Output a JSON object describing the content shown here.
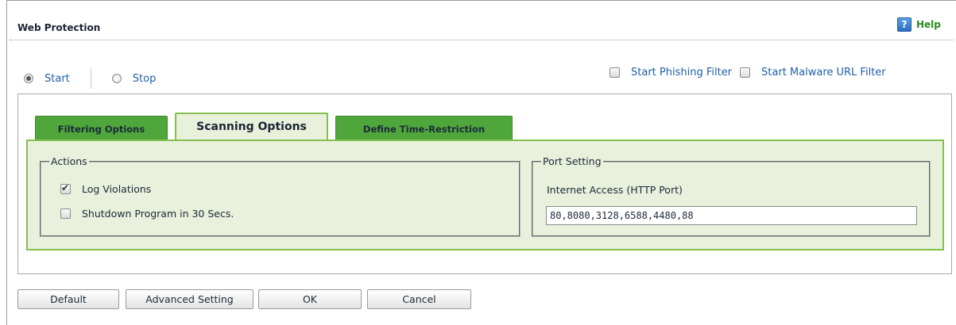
{
  "header": {
    "title": "Web Protection",
    "help_label": "Help",
    "help_icon": "help-question-icon"
  },
  "protection_mode": {
    "options": [
      {
        "label": "Start",
        "selected": true
      },
      {
        "label": "Stop",
        "selected": false
      }
    ]
  },
  "filters": {
    "phishing_label": "Start Phishing Filter",
    "phishing_checked": false,
    "malware_label": "Start Malware URL Filter",
    "malware_checked": false
  },
  "tabs": [
    {
      "label": "Filtering Options",
      "active": false
    },
    {
      "label": "Scanning Options",
      "active": true
    },
    {
      "label": "Define Time-Restriction",
      "active": false
    }
  ],
  "actions": {
    "legend": "Actions",
    "log_violations_label": "Log Violations",
    "log_violations_checked": true,
    "shutdown_label": "Shutdown Program in 30 Secs.",
    "shutdown_checked": false
  },
  "port_setting": {
    "legend": "Port Setting",
    "label": "Internet Access (HTTP Port)",
    "value": "80,8080,3128,6588,4480,88"
  },
  "buttons": {
    "default": "Default",
    "advanced": "Advanced Setting",
    "ok": "OK",
    "cancel": "Cancel"
  },
  "colors": {
    "tab_green": "#4fa63a",
    "panel_green_bg": "#e9f0dc",
    "panel_green_border": "#82c050",
    "link_blue": "#1f5fa8",
    "help_green": "#2a8a1e"
  }
}
